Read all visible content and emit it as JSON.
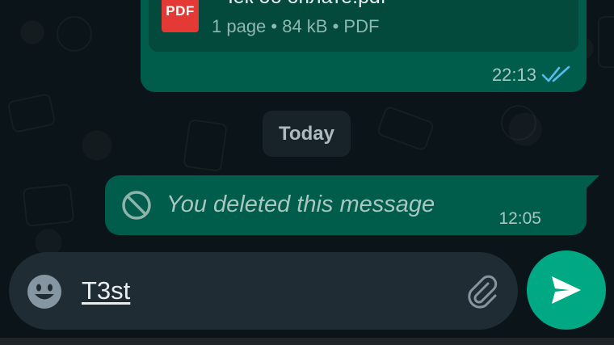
{
  "document_message": {
    "file_icon_label": "PDF",
    "file_name": "Чек об оплате.pdf",
    "meta": "1 page • 84 kB • PDF",
    "time": "22:13",
    "status_icon": "double-check-read-icon",
    "status_color": "#53bdeb"
  },
  "date_divider": {
    "label": "Today"
  },
  "deleted_message": {
    "icon": "ban-icon",
    "text": "You deleted this message",
    "time": "12:05"
  },
  "composer": {
    "emoji_icon": "emoji-icon",
    "input_value": "T3st",
    "attach_icon": "paperclip-icon",
    "send_icon": "send-icon"
  },
  "colors": {
    "outgoing_bubble": "#005c4b",
    "chat_background": "#0b1418",
    "composer_background": "#1f2c33",
    "accent": "#00a884",
    "pdf_red": "#e53935"
  }
}
